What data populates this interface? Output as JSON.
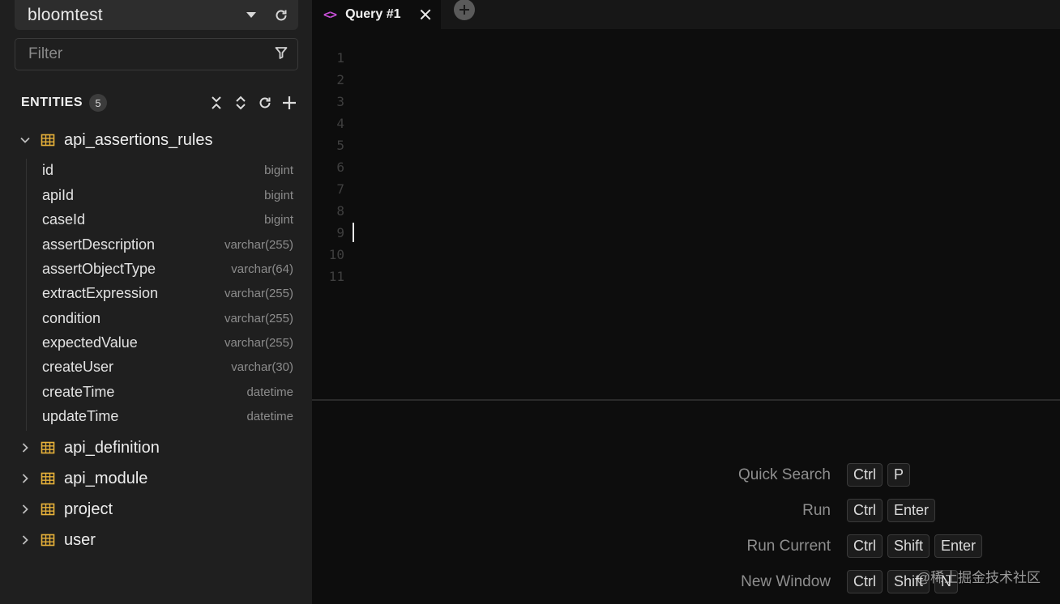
{
  "sidebar": {
    "database": "bloomtest",
    "filter_placeholder": "Filter",
    "entities_label": "ENTITIES",
    "entities_count": "5",
    "tables": [
      {
        "name": "api_assertions_rules",
        "expanded": true,
        "columns": [
          {
            "name": "id",
            "type": "bigint"
          },
          {
            "name": "apiId",
            "type": "bigint"
          },
          {
            "name": "caseId",
            "type": "bigint"
          },
          {
            "name": "assertDescription",
            "type": "varchar(255)"
          },
          {
            "name": "assertObjectType",
            "type": "varchar(64)"
          },
          {
            "name": "extractExpression",
            "type": "varchar(255)"
          },
          {
            "name": "condition",
            "type": "varchar(255)"
          },
          {
            "name": "expectedValue",
            "type": "varchar(255)"
          },
          {
            "name": "createUser",
            "type": "varchar(30)"
          },
          {
            "name": "createTime",
            "type": "datetime"
          },
          {
            "name": "updateTime",
            "type": "datetime"
          }
        ]
      },
      {
        "name": "api_definition",
        "expanded": false
      },
      {
        "name": "api_module",
        "expanded": false
      },
      {
        "name": "project",
        "expanded": false
      },
      {
        "name": "user",
        "expanded": false
      }
    ]
  },
  "tabs": [
    {
      "label": "Query #1",
      "icon": "code-icon",
      "active": true
    }
  ],
  "editor": {
    "line_numbers": [
      "1",
      "2",
      "3",
      "4",
      "5",
      "6",
      "7",
      "8",
      "9",
      "10",
      "11"
    ]
  },
  "shortcuts": [
    {
      "name": "Quick Search",
      "keys": [
        "Ctrl",
        "P"
      ]
    },
    {
      "name": "Run",
      "keys": [
        "Ctrl",
        "Enter"
      ]
    },
    {
      "name": "Run Current",
      "keys": [
        "Ctrl",
        "Shift",
        "Enter"
      ]
    },
    {
      "name": "New Window",
      "keys": [
        "Ctrl",
        "Shift",
        "N"
      ]
    }
  ],
  "watermark": "@稀土掘金技术社区",
  "colors": {
    "accent_code_icon": "#c84fd8",
    "table_icon": "#e8b23a",
    "sidebar_bg": "#1f1f1f",
    "editor_bg": "#0d0d0d"
  }
}
